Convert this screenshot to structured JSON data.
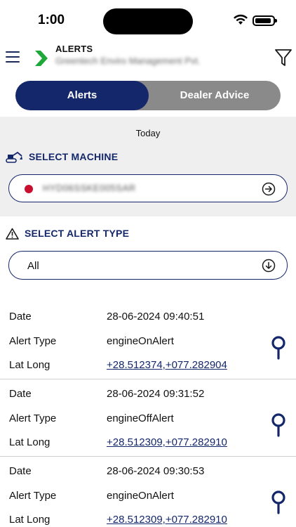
{
  "status_bar": {
    "time": "1:00"
  },
  "header": {
    "title": "ALERTS",
    "company": "Greentech Enviro Management Pvt."
  },
  "tabs": [
    {
      "label": "Alerts",
      "active": true
    },
    {
      "label": "Dealer Advice",
      "active": false
    }
  ],
  "date_label": "Today",
  "machine": {
    "section_label": "SELECT MACHINE",
    "value": "HYD06SSKE005SAR",
    "status_color": "#c8102e"
  },
  "alert_type": {
    "section_label": "SELECT ALERT TYPE",
    "value": "All"
  },
  "labels": {
    "date": "Date",
    "alert_type": "Alert Type",
    "lat_long": "Lat Long"
  },
  "alerts": [
    {
      "date": "28-06-2024 09:40:51",
      "type": "engineOnAlert",
      "latlong": "+28.512374,+077.282904"
    },
    {
      "date": "28-06-2024 09:31:52",
      "type": "engineOffAlert",
      "latlong": "+28.512309,+077.282910"
    },
    {
      "date": "28-06-2024 09:30:53",
      "type": "engineOnAlert",
      "latlong": "+28.512309,+077.282910"
    }
  ],
  "colors": {
    "primary": "#14276b",
    "tab_inactive": "#8a8a8a",
    "section_bg": "#efefef",
    "logo_green": "#1fa83a"
  }
}
